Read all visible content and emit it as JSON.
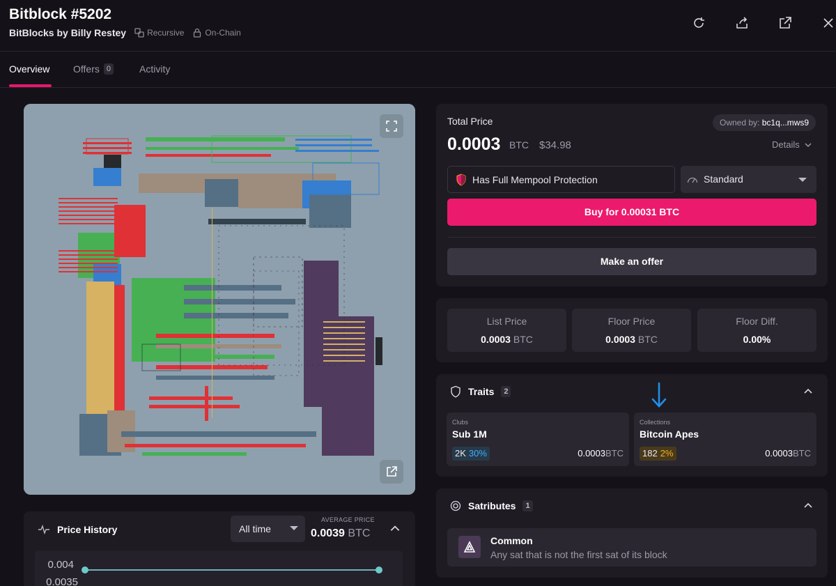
{
  "header": {
    "title": "Bitblock #5202",
    "collection": "BitBlocks by Billy Restey",
    "tag_recursive": "Recursive",
    "tag_onchain": "On-Chain"
  },
  "tabs": {
    "overview": "Overview",
    "offers": "Offers",
    "offers_count": "0",
    "activity": "Activity"
  },
  "price_history": {
    "title": "Price History",
    "range": "All time",
    "avg_label": "AVERAGE PRICE",
    "avg_value": "0.0039",
    "avg_unit": "BTC",
    "tick_1": "0.004",
    "tick_2": "0.0035"
  },
  "purchase": {
    "total_label": "Total Price",
    "price": "0.0003",
    "price_unit": "BTC",
    "usd": "$34.98",
    "owned_label": "Owned by:",
    "owner": "bc1q...mws9",
    "details": "Details",
    "mempool": "Has Full Mempool Protection",
    "fee_option": "Standard",
    "buy": "Buy for 0.00031 BTC",
    "offer": "Make an offer"
  },
  "stats": [
    {
      "label": "List Price",
      "value": "0.0003",
      "unit": "BTC"
    },
    {
      "label": "Floor Price",
      "value": "0.0003",
      "unit": "BTC"
    },
    {
      "label": "Floor Diff.",
      "value": "0.00%",
      "unit": ""
    }
  ],
  "traits": {
    "title": "Traits",
    "count": "2",
    "items": [
      {
        "category": "Clubs",
        "name": "Sub 1M",
        "count": "2K",
        "pct": "30%",
        "price": "0.0003",
        "unit": "BTC"
      },
      {
        "category": "Collections",
        "name": "Bitcoin Apes",
        "count": "182",
        "pct": "2%",
        "price": "0.0003",
        "unit": "BTC"
      }
    ]
  },
  "satributes": {
    "title": "Satributes",
    "count": "1",
    "item_name": "Common",
    "item_desc": "Any sat that is not the first sat of its block"
  },
  "colors": {
    "accent": "#ec1a6d",
    "background": "#141218",
    "card": "#1e1b23",
    "art_bg": "#8ea0ad"
  },
  "icons": [
    "recursive-icon",
    "lock-icon",
    "refresh-icon",
    "share-icon",
    "external-link-icon",
    "close-icon",
    "fullscreen-icon",
    "activity-icon",
    "shield-icon",
    "gauge-icon",
    "chevron-down-icon",
    "chevron-up-icon",
    "satribute-icon",
    "arrow-down-icon"
  ]
}
